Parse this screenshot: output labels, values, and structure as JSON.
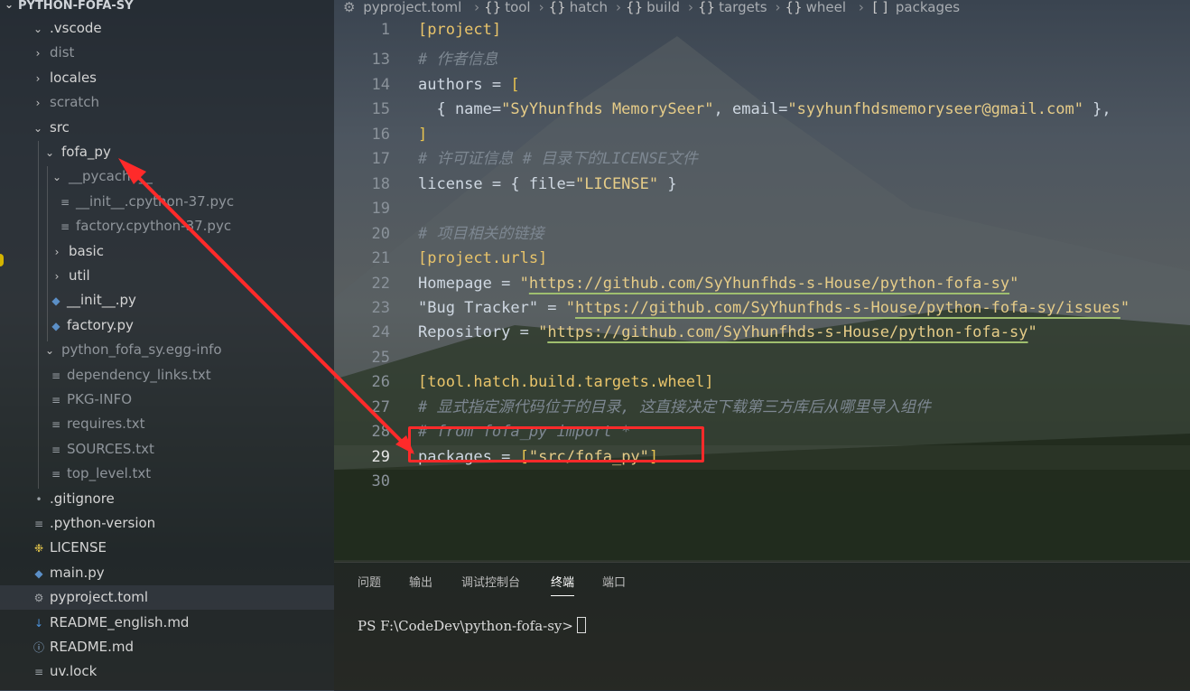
{
  "explorer": {
    "root_label": "PYTHON-FOFA-SY",
    "items": [
      {
        "label": ".vscode",
        "type": "folder-open",
        "indent": 0,
        "dim": false
      },
      {
        "label": "dist",
        "type": "folder-closed",
        "indent": 0,
        "dim": true
      },
      {
        "label": "locales",
        "type": "folder-closed",
        "indent": 0,
        "dim": false
      },
      {
        "label": "scratch",
        "type": "folder-closed",
        "indent": 0,
        "dim": true
      },
      {
        "label": "src",
        "type": "folder-open",
        "indent": 0,
        "dim": false
      },
      {
        "label": "fofa_py",
        "type": "folder-open",
        "indent": 1,
        "dim": false
      },
      {
        "label": "__pycache__",
        "type": "folder-open",
        "indent": 2,
        "dim": true
      },
      {
        "label": "__init__.cpython-37.pyc",
        "type": "file-lines",
        "indent": 3,
        "dim": true
      },
      {
        "label": "factory.cpython-37.pyc",
        "type": "file-lines",
        "indent": 3,
        "dim": true
      },
      {
        "label": "basic",
        "type": "folder-closed",
        "indent": 2,
        "dim": false
      },
      {
        "label": "util",
        "type": "folder-closed",
        "indent": 2,
        "dim": false
      },
      {
        "label": "__init__.py",
        "type": "python",
        "indent": 2,
        "dim": false
      },
      {
        "label": "factory.py",
        "type": "python",
        "indent": 2,
        "dim": false
      },
      {
        "label": "python_fofa_sy.egg-info",
        "type": "folder-open",
        "indent": 1,
        "dim": true
      },
      {
        "label": "dependency_links.txt",
        "type": "file-lines",
        "indent": 2,
        "dim": true
      },
      {
        "label": "PKG-INFO",
        "type": "file-lines",
        "indent": 2,
        "dim": true
      },
      {
        "label": "requires.txt",
        "type": "file-lines",
        "indent": 2,
        "dim": true
      },
      {
        "label": "SOURCES.txt",
        "type": "file-lines",
        "indent": 2,
        "dim": true
      },
      {
        "label": "top_level.txt",
        "type": "file-lines",
        "indent": 2,
        "dim": true
      },
      {
        "label": ".gitignore",
        "type": "dot",
        "indent": 0,
        "dim": false
      },
      {
        "label": ".python-version",
        "type": "file-lines",
        "indent": 0,
        "dim": false
      },
      {
        "label": "LICENSE",
        "type": "key",
        "indent": 0,
        "dim": false
      },
      {
        "label": "main.py",
        "type": "python",
        "indent": 0,
        "dim": false
      },
      {
        "label": "pyproject.toml",
        "type": "gear",
        "indent": 0,
        "dim": false,
        "selected": true
      },
      {
        "label": "README_english.md",
        "type": "md",
        "indent": 0,
        "dim": false
      },
      {
        "label": "README.md",
        "type": "info",
        "indent": 0,
        "dim": false
      },
      {
        "label": "uv.lock",
        "type": "file-lines",
        "indent": 0,
        "dim": false
      }
    ]
  },
  "breadcrumb": {
    "file": "pyproject.toml",
    "parts": [
      "tool",
      "hatch",
      "build",
      "targets",
      "wheel"
    ],
    "last": "packages"
  },
  "editor": {
    "current_line": 29,
    "lines": [
      {
        "n": "1",
        "tokens": [
          {
            "t": "[project]",
            "c": "sec"
          }
        ]
      },
      {
        "n": "13",
        "tokens": [
          {
            "t": "# 作者信息",
            "c": "cm"
          }
        ]
      },
      {
        "n": "14",
        "tokens": [
          {
            "t": "authors = ",
            "c": "key"
          },
          {
            "t": "[",
            "c": "br"
          }
        ]
      },
      {
        "n": "15",
        "tokens": [
          {
            "t": "  { name=",
            "c": "key"
          },
          {
            "t": "\"SyYhunfhds MemorySeer\"",
            "c": "str"
          },
          {
            "t": ", email=",
            "c": "key"
          },
          {
            "t": "\"syyhunfhdsmemoryseer@gmail.com\"",
            "c": "str"
          },
          {
            "t": " },",
            "c": "key"
          }
        ]
      },
      {
        "n": "16",
        "tokens": [
          {
            "t": "]",
            "c": "br"
          }
        ]
      },
      {
        "n": "17",
        "tokens": [
          {
            "t": "# 许可证信息 # 目录下的LICENSE文件",
            "c": "cm"
          }
        ]
      },
      {
        "n": "18",
        "tokens": [
          {
            "t": "license = { file=",
            "c": "key"
          },
          {
            "t": "\"LICENSE\"",
            "c": "str"
          },
          {
            "t": " }",
            "c": "key"
          }
        ]
      },
      {
        "n": "19",
        "tokens": []
      },
      {
        "n": "20",
        "tokens": [
          {
            "t": "# 项目相关的链接",
            "c": "cm"
          }
        ]
      },
      {
        "n": "21",
        "tokens": [
          {
            "t": "[project.urls]",
            "c": "sec"
          }
        ]
      },
      {
        "n": "22",
        "tokens": [
          {
            "t": "Homepage = ",
            "c": "key"
          },
          {
            "t": "\"",
            "c": "str"
          },
          {
            "t": "https://github.com/SyYhunfhds-s-House/python-fofa-sy",
            "c": "url"
          },
          {
            "t": "\"",
            "c": "str"
          }
        ]
      },
      {
        "n": "23",
        "tokens": [
          {
            "t": "\"Bug Tracker\" = ",
            "c": "key"
          },
          {
            "t": "\"",
            "c": "str"
          },
          {
            "t": "https://github.com/SyYhunfhds-s-House/python-fofa-sy/issues",
            "c": "url"
          },
          {
            "t": "\"",
            "c": "str"
          }
        ]
      },
      {
        "n": "24",
        "tokens": [
          {
            "t": "Repository = ",
            "c": "key"
          },
          {
            "t": "\"",
            "c": "str"
          },
          {
            "t": "https://github.com/SyYhunfhds-s-House/python-fofa-sy",
            "c": "url"
          },
          {
            "t": "\"",
            "c": "str"
          }
        ]
      },
      {
        "n": "25",
        "tokens": []
      },
      {
        "n": "26",
        "tokens": [
          {
            "t": "[tool.hatch.build.targets.wheel]",
            "c": "sec"
          }
        ]
      },
      {
        "n": "27",
        "tokens": [
          {
            "t": "# 显式指定源代码位于的目录, 这直接决定下载第三方库后从哪里导入组件",
            "c": "cm"
          }
        ]
      },
      {
        "n": "28",
        "tokens": [
          {
            "t": "# from fofa_py import *",
            "c": "cm"
          }
        ]
      },
      {
        "n": "29",
        "tokens": [
          {
            "t": "packages = ",
            "c": "key"
          },
          {
            "t": "[",
            "c": "br"
          },
          {
            "t": "\"src/fofa_py\"",
            "c": "str"
          },
          {
            "t": "]",
            "c": "br"
          }
        ]
      },
      {
        "n": "30",
        "tokens": []
      }
    ]
  },
  "panel": {
    "tabs": [
      "问题",
      "输出",
      "调试控制台",
      "终端",
      "端口"
    ],
    "active_tab": "终端",
    "terminal_prompt": "PS F:\\CodeDev\\python-fofa-sy>"
  },
  "colors": {
    "annotation_red": "#ff2a2a",
    "toml_section": "#e9c46a",
    "string": "#e6cc88",
    "comment": "#7d8791"
  }
}
